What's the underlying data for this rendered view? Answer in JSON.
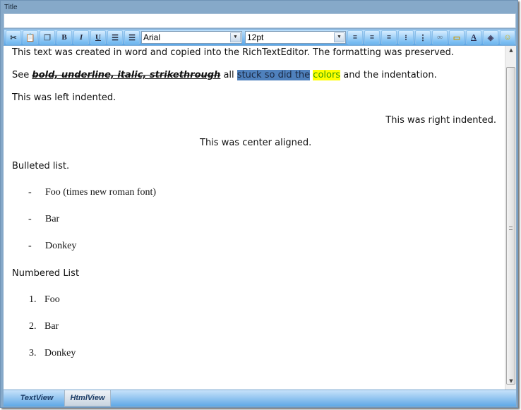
{
  "title_label": "Title",
  "title_value": "",
  "toolbar": {
    "buttons": [
      "cut",
      "paste",
      "copy",
      "bold",
      "italic",
      "underline",
      "outdent",
      "indent"
    ],
    "bold": "B",
    "italic": "I",
    "underline": "U",
    "font": "Arial",
    "size": "12pt",
    "right_buttons": [
      "align-left",
      "align-center",
      "align-right",
      "bulleted-list",
      "numbered-list",
      "link",
      "insert-image",
      "font-color",
      "highlight-color",
      "emoticon"
    ]
  },
  "content": {
    "line1": "This text was created in word and copied into the RichTextEditor. The formatting was preserved.",
    "line2_see": "See ",
    "line2_fmt": "bold, underline, italic, strikethrough",
    "line2_all": " all ",
    "line2_blue": "stuck so did the",
    "line2_sp": " ",
    "line2_yellow": "colors",
    "line2_end": " and the indentation.",
    "left": "This was left indented.",
    "right": "This was right indented.",
    "center": "This was center aligned.",
    "bulleted_heading": "Bulleted list.",
    "bullets": [
      {
        "marker": "-",
        "text": "Foo (times new roman font)"
      },
      {
        "marker": "-",
        "text": "Bar"
      },
      {
        "marker": "-",
        "text": "Donkey"
      }
    ],
    "numbered_heading": "Numbered List",
    "numbers": [
      {
        "marker": "1.",
        "text": "Foo"
      },
      {
        "marker": "2.",
        "text": "Bar"
      },
      {
        "marker": "3.",
        "text": "Donkey"
      }
    ]
  },
  "tabs": [
    {
      "label": "TextView",
      "active": true
    },
    {
      "label": "HtmlView",
      "active": false
    }
  ],
  "colors": {
    "highlight_blue": "#4f81bd",
    "highlight_yellow": "#ffff00",
    "text_green": "#3aa000"
  }
}
